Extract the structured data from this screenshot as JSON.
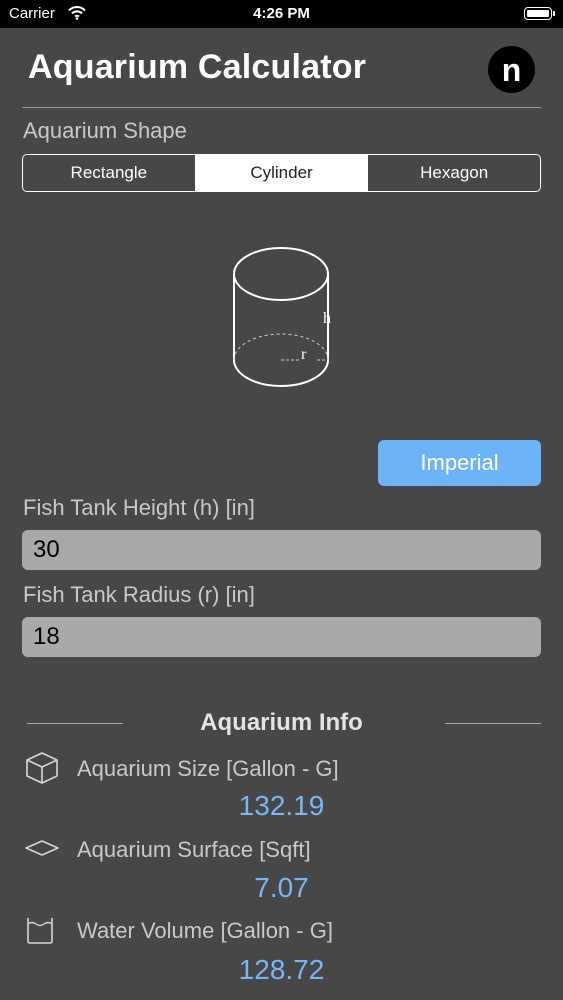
{
  "status_bar": {
    "carrier": "Carrier",
    "time": "4:26 PM"
  },
  "header": {
    "title": "Aquarium Calculator",
    "logo_letter": "n"
  },
  "shape_section": {
    "label": "Aquarium Shape",
    "options": [
      "Rectangle",
      "Cylinder",
      "Hexagon"
    ],
    "selected": "Cylinder"
  },
  "diagram": {
    "height_label": "h",
    "radius_label": "r"
  },
  "unit_button": {
    "label": "Imperial"
  },
  "inputs": {
    "height": {
      "label": "Fish Tank Height (h)  [in]",
      "value": "30"
    },
    "radius": {
      "label": "Fish Tank Radius (r)  [in]",
      "value": "18"
    }
  },
  "info": {
    "title": "Aquarium Info",
    "items": [
      {
        "icon": "cube-icon",
        "label": "Aquarium Size [Gallon - G]",
        "value": "132.19"
      },
      {
        "icon": "surface-icon",
        "label": "Aquarium Surface [Sqft]",
        "value": "7.07"
      },
      {
        "icon": "water-tank-icon",
        "label": "Water Volume [Gallon - G]",
        "value": "128.72"
      }
    ]
  },
  "colors": {
    "background": "#474747",
    "accent": "#6db3f8",
    "value_text": "#79b6f6",
    "input_bg": "#a9a9a9"
  }
}
